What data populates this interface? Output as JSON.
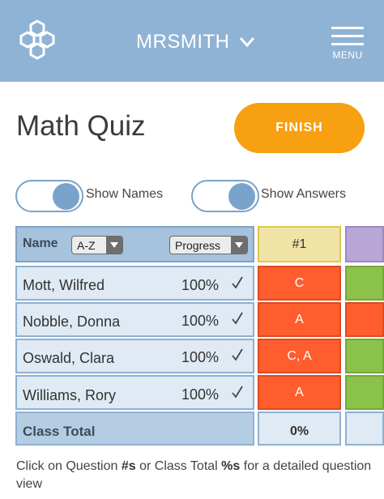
{
  "header": {
    "username": "MRSMITH",
    "menu_label": "MENU",
    "icons": {
      "logo": "hexagon-molecule-icon",
      "user_dropdown": "chevron-down-icon",
      "menu": "hamburger-icon"
    }
  },
  "page": {
    "title": "Math Quiz",
    "finish_label": "FINISH"
  },
  "toggles": {
    "names": {
      "label": "Show Names",
      "on": true
    },
    "answers": {
      "label": "Show Answers",
      "on": true
    }
  },
  "table": {
    "name_header": "Name",
    "sort_select": "A-Z",
    "progress_select": "Progress",
    "question_header": "#1",
    "students": [
      {
        "name": "Mott, Wilfred",
        "progress": "100%",
        "answer": "C"
      },
      {
        "name": "Nobble, Donna",
        "progress": "100%",
        "answer": "A"
      },
      {
        "name": "Oswald, Clara",
        "progress": "100%",
        "answer": "C, A"
      },
      {
        "name": "Williams, Rory",
        "progress": "100%",
        "answer": "A"
      }
    ],
    "total_label": "Class Total",
    "total_value": "0%"
  },
  "footer": {
    "part1": "Click on Question ",
    "bold1": "#s",
    "part2": " or Class Total ",
    "bold2": "%s",
    "part3": " for a detailed question view"
  },
  "colors": {
    "header_bg": "#8fb3d4",
    "finish_button": "#f7a011",
    "answer_wrong": "#ff5d2d",
    "answer_right": "#8bc34a",
    "question_header": "#f1e3a6",
    "next_question_header": "#b8a6d6"
  }
}
